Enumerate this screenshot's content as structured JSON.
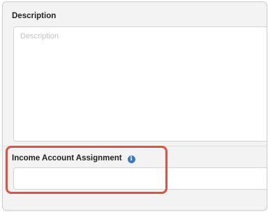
{
  "description": {
    "label": "Description",
    "placeholder": "Description",
    "value": ""
  },
  "income_account": {
    "label": "Income Account Assignment",
    "info_icon": "info-icon",
    "value": ""
  },
  "colors": {
    "highlight": "#e0523f",
    "info_icon": "#3b79c7"
  }
}
